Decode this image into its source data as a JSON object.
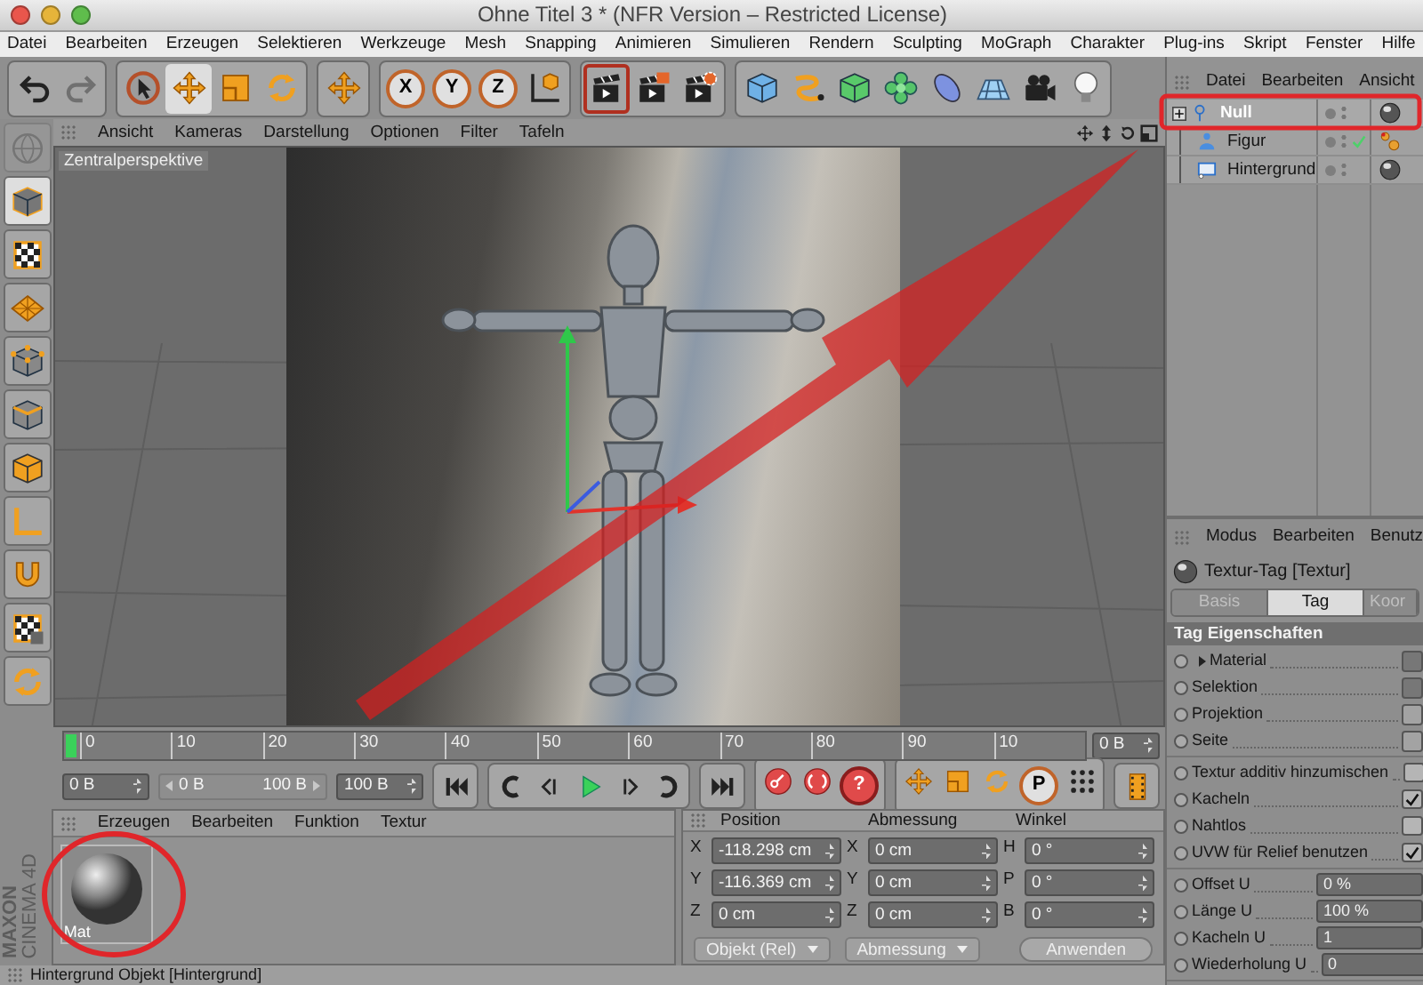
{
  "window": {
    "title": "Ohne Titel 3 * (NFR Version – Restricted License)"
  },
  "menu": [
    "Datei",
    "Bearbeiten",
    "Erzeugen",
    "Selektieren",
    "Werkzeuge",
    "Mesh",
    "Snapping",
    "Animieren",
    "Simulieren",
    "Rendern",
    "Sculpting",
    "MoGraph",
    "Charakter",
    "Plug-ins",
    "Skript",
    "Fenster",
    "Hilfe"
  ],
  "toolbar": [
    [
      {
        "kind": "undo",
        "selected": false,
        "disabled": false
      },
      {
        "kind": "redo",
        "selected": false,
        "disabled": true
      }
    ],
    [
      {
        "kind": "cursor",
        "selected": false,
        "disabled": false
      },
      {
        "kind": "move-arrows",
        "selected": true,
        "disabled": false
      },
      {
        "kind": "scale-square",
        "selected": false,
        "disabled": false
      },
      {
        "kind": "rotate-arrows",
        "selected": false,
        "disabled": false
      }
    ],
    [
      {
        "kind": "plus-arrows",
        "selected": false,
        "disabled": false
      }
    ],
    [
      {
        "kind": "axis",
        "label": "X",
        "selected": false,
        "disabled": false
      },
      {
        "kind": "axis",
        "label": "Y",
        "selected": false,
        "disabled": false
      },
      {
        "kind": "axis",
        "label": "Z",
        "selected": false,
        "disabled": false
      },
      {
        "kind": "axis-cube",
        "selected": false,
        "disabled": false
      }
    ],
    [
      {
        "kind": "clapperboard",
        "selected": true,
        "disabled": false
      },
      {
        "kind": "clapperboard-render",
        "selected": false,
        "disabled": false
      },
      {
        "kind": "clapperboard-gear",
        "selected": false,
        "disabled": false
      }
    ],
    [
      {
        "kind": "cube",
        "selected": false,
        "disabled": false
      },
      {
        "kind": "spline",
        "selected": false,
        "disabled": false
      },
      {
        "kind": "subdivision-cube",
        "selected": false,
        "disabled": false
      },
      {
        "kind": "flower",
        "selected": false,
        "disabled": false
      },
      {
        "kind": "ellipse",
        "selected": false,
        "disabled": false
      },
      {
        "kind": "floor-grid",
        "selected": false,
        "disabled": false
      },
      {
        "kind": "camera",
        "selected": false,
        "disabled": false
      },
      {
        "kind": "light-bulb",
        "selected": false,
        "disabled": false
      }
    ]
  ],
  "left_tools": [
    {
      "kind": "globe",
      "selected": false,
      "disabled": true
    },
    {
      "kind": "cube-outline",
      "selected": true,
      "disabled": false
    },
    {
      "kind": "tile-pattern",
      "selected": false,
      "disabled": false
    },
    {
      "kind": "diamond-grid",
      "selected": false,
      "disabled": false
    },
    {
      "kind": "cube-points",
      "selected": false,
      "disabled": false
    },
    {
      "kind": "cube-edges",
      "selected": false,
      "disabled": false
    },
    {
      "kind": "cube-faces",
      "selected": false,
      "disabled": false
    },
    {
      "kind": "corner-axis",
      "selected": false,
      "disabled": false
    },
    {
      "kind": "magnet",
      "selected": false,
      "disabled": false
    },
    {
      "kind": "tile-lock",
      "selected": false,
      "disabled": false
    },
    {
      "kind": "rotate-lock",
      "selected": false,
      "disabled": false
    }
  ],
  "viewport": {
    "menu": [
      "Ansicht",
      "Kameras",
      "Darstellung",
      "Optionen",
      "Filter",
      "Tafeln"
    ],
    "label": "Zentralperspektive"
  },
  "timeline": {
    "ticks": [
      "0",
      "10",
      "20",
      "30",
      "40",
      "50",
      "60",
      "70",
      "80",
      "90",
      "10"
    ],
    "level": 0,
    "frame_field": "0 B"
  },
  "transport": {
    "start_field": "0 B",
    "range_start": "0 B",
    "range_end": "100 B",
    "range_disabled": true,
    "end_field": "100 B",
    "groups": [
      [
        {
          "kind": "skip-start"
        }
      ],
      [
        {
          "kind": "key-back"
        },
        {
          "kind": "step-back"
        },
        {
          "kind": "play"
        },
        {
          "kind": "step-forward"
        },
        {
          "kind": "key-forward"
        }
      ],
      [
        {
          "kind": "skip-end"
        }
      ],
      [
        {
          "kind": "record-key"
        },
        {
          "kind": "autokey"
        },
        {
          "kind": "help",
          "label": "?"
        }
      ],
      [
        {
          "kind": "move-arrows"
        },
        {
          "kind": "scale-square"
        },
        {
          "kind": "rotate-arrows"
        },
        {
          "kind": "letter",
          "label": "P"
        },
        {
          "kind": "dots-grid"
        }
      ],
      [
        {
          "kind": "film-strip"
        }
      ]
    ]
  },
  "logo": [
    "MAXON",
    "CINEMA 4D"
  ],
  "material_manager": {
    "menu": [
      "Erzeugen",
      "Bearbeiten",
      "Funktion",
      "Textur"
    ],
    "materials": [
      {
        "name": "Mat",
        "selected": false
      }
    ]
  },
  "coordinates": {
    "headings": [
      "Position",
      "Abmessung",
      "Winkel"
    ],
    "rows": [
      {
        "axes": [
          "X",
          "X",
          "H"
        ],
        "values": [
          "-118.298 cm",
          "0 cm",
          "0 °"
        ]
      },
      {
        "axes": [
          "Y",
          "Y",
          "P"
        ],
        "values": [
          "-116.369 cm",
          "0 cm",
          "0 °"
        ]
      },
      {
        "axes": [
          "Z",
          "Z",
          "B"
        ],
        "values": [
          "0 cm",
          "0 cm",
          "0 °"
        ]
      }
    ],
    "dropdowns": [
      "Objekt (Rel)",
      "Abmessung"
    ],
    "apply_button": "Anwenden"
  },
  "status_bar": "Hintergrund Objekt [Hintergrund]",
  "object_manager": {
    "menu": [
      "Datei",
      "Bearbeiten",
      "Ansicht"
    ],
    "objects": [
      {
        "name": "Null",
        "kind": "null",
        "selected": true,
        "expanded": false,
        "checked": false,
        "tags": [
          {
            "kind": "texture"
          }
        ]
      },
      {
        "name": "Figur",
        "kind": "figure",
        "selected": false,
        "checked": true,
        "tags": [
          {
            "kind": "dots"
          }
        ]
      },
      {
        "name": "Hintergrund",
        "kind": "background",
        "selected": false,
        "checked": false,
        "tags": [
          {
            "kind": "texture"
          }
        ]
      }
    ]
  },
  "attributes": {
    "menu": [
      "Modus",
      "Bearbeiten",
      "Benutz"
    ],
    "title": "Textur-Tag [Textur]",
    "tabs": [
      {
        "label": "Basis",
        "selected": false
      },
      {
        "label": "Tag",
        "selected": true
      },
      {
        "label": "Koor",
        "selected": false
      }
    ],
    "section": "Tag Eigenschaften",
    "groups": [
      [
        {
          "label": "Material",
          "kind": "link",
          "expandable": true
        },
        {
          "label": "Selektion",
          "kind": "link",
          "expandable": false
        },
        {
          "label": "Projektion",
          "kind": "choice",
          "expandable": false
        },
        {
          "label": "Seite",
          "kind": "choice",
          "expandable": false
        }
      ],
      [
        {
          "label": "Textur additiv hinzumischen",
          "kind": "checkbox",
          "checked": false
        },
        {
          "label": "Kacheln",
          "kind": "checkbox",
          "checked": true
        },
        {
          "label": "Nahtlos",
          "kind": "checkbox",
          "checked": false
        },
        {
          "label": "UVW für Relief benutzen",
          "kind": "checkbox",
          "checked": true
        }
      ],
      [
        {
          "label": "Offset U",
          "kind": "number",
          "value": "0 %"
        },
        {
          "label": "Länge U",
          "kind": "number",
          "value": "100 %"
        },
        {
          "label": "Kacheln U",
          "kind": "number",
          "value": "1"
        },
        {
          "label": "Wiederholung U",
          "kind": "number",
          "value": "0"
        }
      ]
    ]
  }
}
